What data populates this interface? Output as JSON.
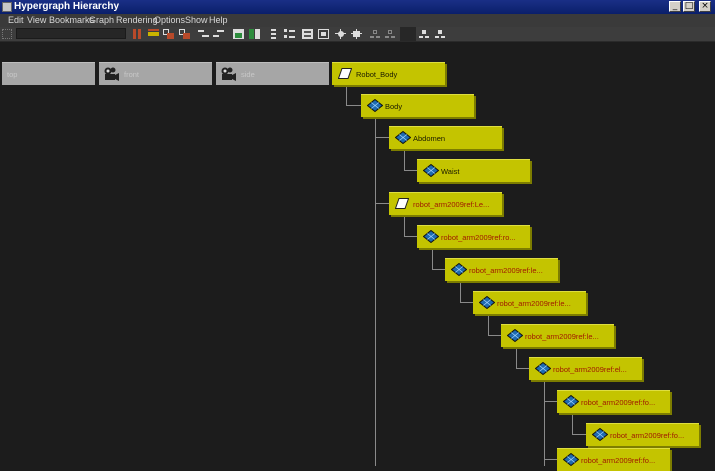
{
  "window": {
    "title": "Hypergraph Hierarchy",
    "buttons": [
      "_",
      "□",
      "×"
    ]
  },
  "menu": [
    "Edit",
    "View",
    "Bookmarks",
    "Graph",
    "Rendering",
    "Options",
    "Show",
    "Help"
  ],
  "cameras": [
    {
      "label": "top"
    },
    {
      "label": "front"
    },
    {
      "label": "side"
    }
  ],
  "nodes": [
    {
      "label": "Robot_Body",
      "icon": "parallelogram-icon",
      "red": false
    },
    {
      "label": "Body",
      "icon": "mesh-icon",
      "red": false
    },
    {
      "label": "Abdomen",
      "icon": "mesh-icon",
      "red": false
    },
    {
      "label": "Waist",
      "icon": "mesh-icon",
      "red": false
    },
    {
      "label": "robot_arm2009ref:Le...",
      "icon": "parallelogram-icon",
      "red": true
    },
    {
      "label": "robot_arm2009ref:ro...",
      "icon": "mesh-icon",
      "red": true
    },
    {
      "label": "robot_arm2009ref:le...",
      "icon": "mesh-icon",
      "red": true
    },
    {
      "label": "robot_arm2009ref:le...",
      "icon": "mesh-icon",
      "red": true
    },
    {
      "label": "robot_arm2009ref:le...",
      "icon": "mesh-icon",
      "red": true
    },
    {
      "label": "robot_arm2009ref:el...",
      "icon": "mesh-icon",
      "red": true
    },
    {
      "label": "robot_arm2009ref:fo...",
      "icon": "mesh-icon",
      "red": true
    },
    {
      "label": "robot_arm2009ref:fo...",
      "icon": "mesh-icon",
      "red": true
    },
    {
      "label": "robot_arm2009ref:fo...",
      "icon": "mesh-icon",
      "red": true
    }
  ]
}
